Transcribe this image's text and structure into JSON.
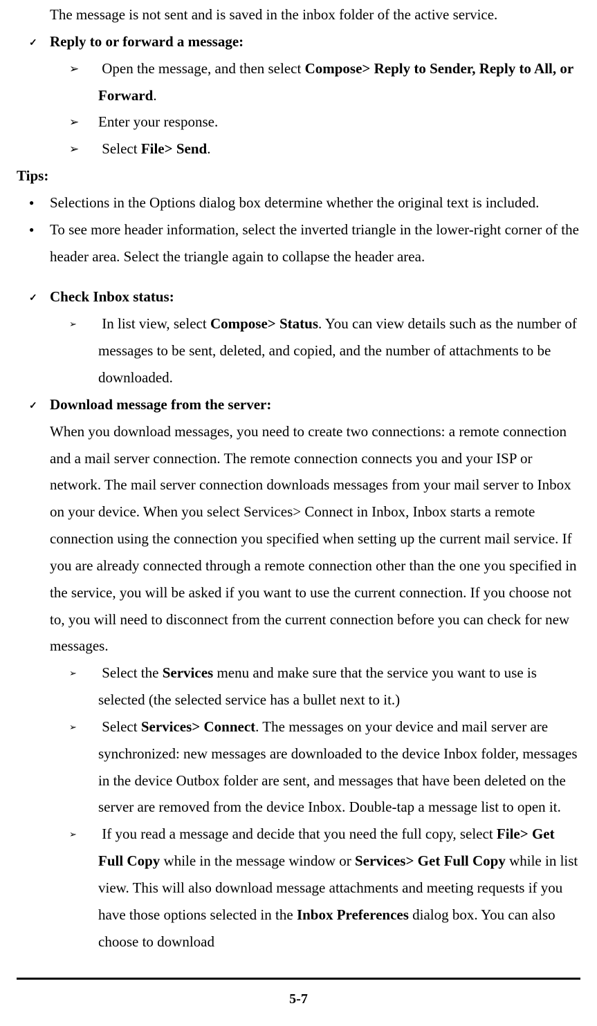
{
  "p_intro": "The message is not sent and is saved in the inbox folder of the active service.",
  "reply_heading": "Reply to or forward a message:",
  "reply_step1_a": "Open the message, and then select ",
  "reply_step1_b": "Compose> Reply to Sender, Reply to All, or Forward",
  "reply_step1_c": ".",
  "reply_step2": "Enter your response.",
  "reply_step3_a": "Select ",
  "reply_step3_b": "File> Send",
  "reply_step3_c": ".",
  "tips_label": "Tips:",
  "tip1": "Selections in the Options dialog box determine whether the original text is included.",
  "tip2": "To see more header information, select the inverted triangle in the lower-right corner of the header area. Select the triangle again to collapse the header area.",
  "check_inbox_heading": "Check Inbox status:",
  "check_inbox_a": "In list view, select ",
  "check_inbox_b": "Compose> Status",
  "check_inbox_c": ". You can view details such as the number of messages to be sent, deleted, and copied, and the number of attachments to be downloaded.",
  "download_heading": "Download message from the server:",
  "download_para": "When you download messages, you need to create two connections: a remote connection and a mail server connection. The remote connection connects you and your ISP or network. The mail server connection downloads messages from your mail server to Inbox on your device. When you select Services> Connect in Inbox, Inbox starts a remote connection using the connection you specified when setting up the current mail service. If you are already connected through a remote connection other than the one you specified in the service, you will be asked if you want to use the current connection. If you choose not to, you will need to disconnect from the current connection before you can check for new messages.",
  "dl_step1_a": "Select the ",
  "dl_step1_b": "Services",
  "dl_step1_c": " menu and make sure that the service you want to use is selected (the selected service has a bullet next to it.)",
  "dl_step2_a": "Select ",
  "dl_step2_b": "Services> Connect",
  "dl_step2_c": ". The messages on your device and mail server are synchronized: new messages are downloaded to the device Inbox folder, messages in the device Outbox folder are sent, and messages that have been deleted on the server are removed from the device Inbox. Double-tap a message list to open it.",
  "dl_step3_a": "If you read a message and decide that you need the full copy, select ",
  "dl_step3_b": "File> Get Full Copy",
  "dl_step3_c": " while in the message window or ",
  "dl_step3_d": "Services> Get Full Copy",
  "dl_step3_e": " while in list view. This will also download message attachments and meeting requests if you have those options selected in the ",
  "dl_step3_f": "Inbox Preferences",
  "dl_step3_g": " dialog box. You can also choose to download",
  "page_number": "5-7"
}
